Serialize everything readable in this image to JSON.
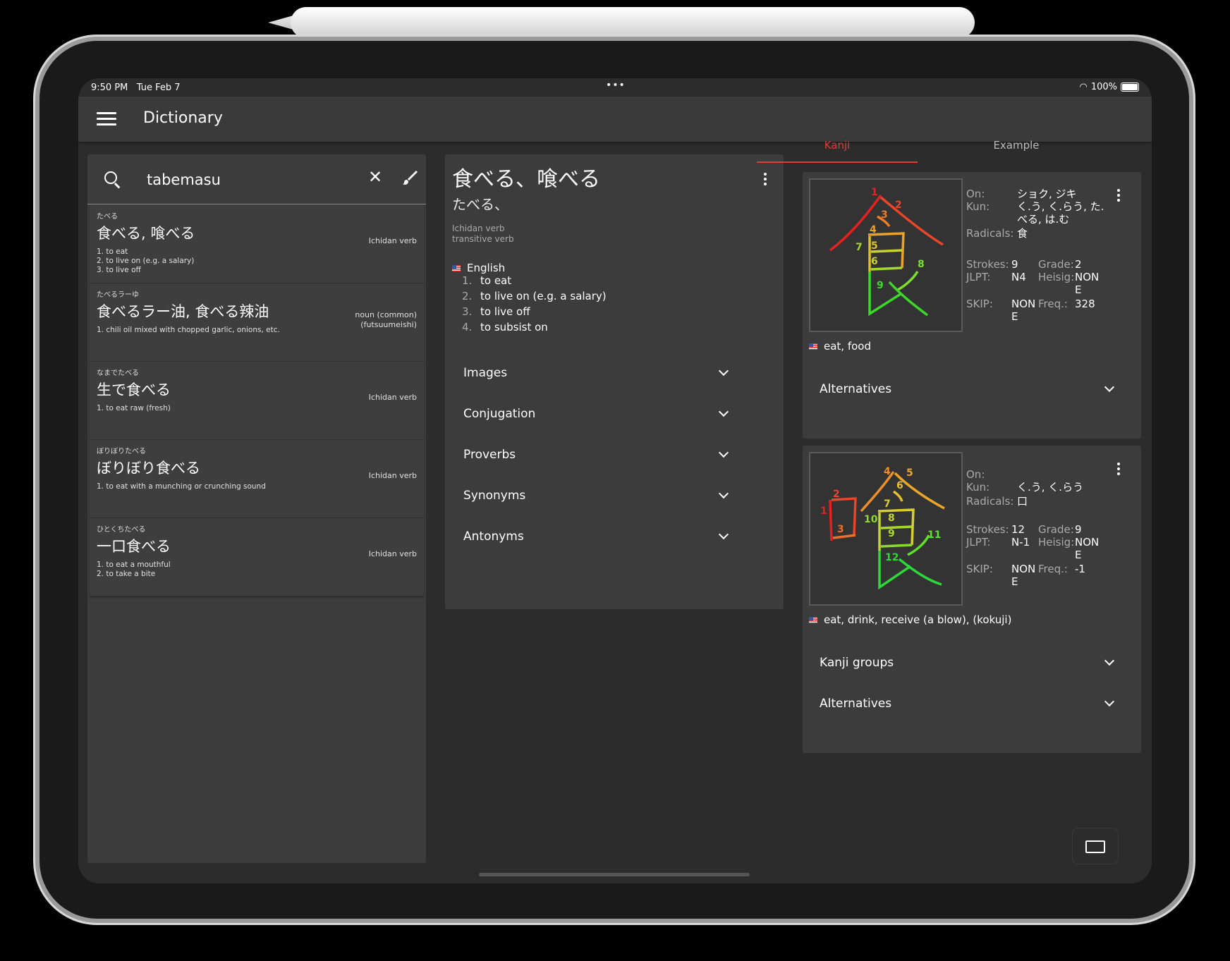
{
  "status": {
    "time": "9:50 PM",
    "date": "Tue Feb 7",
    "battery": "100%",
    "center_dots": "•••"
  },
  "appbar": {
    "title": "Dictionary"
  },
  "search": {
    "value": "tabemasu",
    "placeholder": ""
  },
  "results": [
    {
      "reading": "たべる",
      "word": "食べる, 喰べる",
      "defs": [
        "1. to eat",
        "2. to live on (e.g. a salary)",
        "3. to live off"
      ],
      "type": [
        "Ichidan verb"
      ]
    },
    {
      "reading": "たべるラーゆ",
      "word": "食べるラー油, 食べる辣油",
      "defs": [
        "1. chili oil mixed with chopped garlic, onions, etc."
      ],
      "type": [
        "noun (common)",
        "(futsuumeishi)"
      ]
    },
    {
      "reading": "なまでたべる",
      "word": "生で食べる",
      "defs": [
        "1. to eat raw (fresh)"
      ],
      "type": [
        "Ichidan verb"
      ]
    },
    {
      "reading": "ぼりぼりたべる",
      "word": "ぼりぼり食べる",
      "defs": [
        "1. to eat with a munching or crunching sound"
      ],
      "type": [
        "Ichidan verb"
      ]
    },
    {
      "reading": "ひとくちたべる",
      "word": "一口食べる",
      "defs": [
        "1. to eat a mouthful",
        "2. to take a bite"
      ],
      "type": [
        "Ichidan verb"
      ]
    }
  ],
  "detail": {
    "title": "食べる、喰べる",
    "reading": "たべる、",
    "tags": [
      "Ichidan verb",
      "transitive verb"
    ],
    "language": "English",
    "senses": [
      {
        "num": "1.",
        "text": "to eat"
      },
      {
        "num": "2.",
        "text": "to live on (e.g. a salary)"
      },
      {
        "num": "3.",
        "text": "to live off"
      },
      {
        "num": "4.",
        "text": "to subsist on"
      }
    ],
    "sections": [
      "Images",
      "Conjugation",
      "Proverbs",
      "Synonyms",
      "Antonyms"
    ]
  },
  "tabs": {
    "kanji": "Kanji",
    "example": "Example",
    "accent": "#e53935"
  },
  "kanji": [
    {
      "character": "食",
      "on_label": "On:",
      "on": "ショク, ジキ",
      "kun_label": "Kun:",
      "kun": [
        "く.う, く.らう, た.",
        "べる, は.む"
      ],
      "radicals_label": "Radicals:",
      "radicals": "食",
      "strokes_label": "Strokes:",
      "strokes": "9",
      "grade_label": "Grade:",
      "grade": "2",
      "jlpt_label": "JLPT:",
      "jlpt": "N4",
      "heisig_label": "Heisig:",
      "heisig": [
        "NON",
        "E"
      ],
      "skip_label": "SKIP:",
      "skip": [
        "NON",
        "E"
      ],
      "freq_label": "Freq.:",
      "freq": "328",
      "meaning": "eat, food",
      "sections": [
        "Alternatives"
      ]
    },
    {
      "character": "喰",
      "on_label": "On:",
      "on": "",
      "kun_label": "Kun:",
      "kun": [
        "く.う, く.らう"
      ],
      "radicals_label": "Radicals:",
      "radicals": "口",
      "strokes_label": "Strokes:",
      "strokes": "12",
      "grade_label": "Grade:",
      "grade": "9",
      "jlpt_label": "JLPT:",
      "jlpt": "N-1",
      "heisig_label": "Heisig:",
      "heisig": [
        "NON",
        "E"
      ],
      "skip_label": "SKIP:",
      "skip": [
        "NON",
        "E"
      ],
      "freq_label": "Freq.:",
      "freq": "-1",
      "meaning": "eat, drink, receive (a blow), (kokuji)",
      "sections": [
        "Kanji groups",
        "Alternatives"
      ]
    }
  ],
  "stroke_numbers_1": [
    "1",
    "2",
    "3",
    "4",
    "5",
    "6",
    "7",
    "8",
    "9"
  ],
  "stroke_numbers_2": [
    "1",
    "2",
    "3",
    "4",
    "5",
    "6",
    "7",
    "8",
    "9",
    "10",
    "11",
    "12"
  ]
}
